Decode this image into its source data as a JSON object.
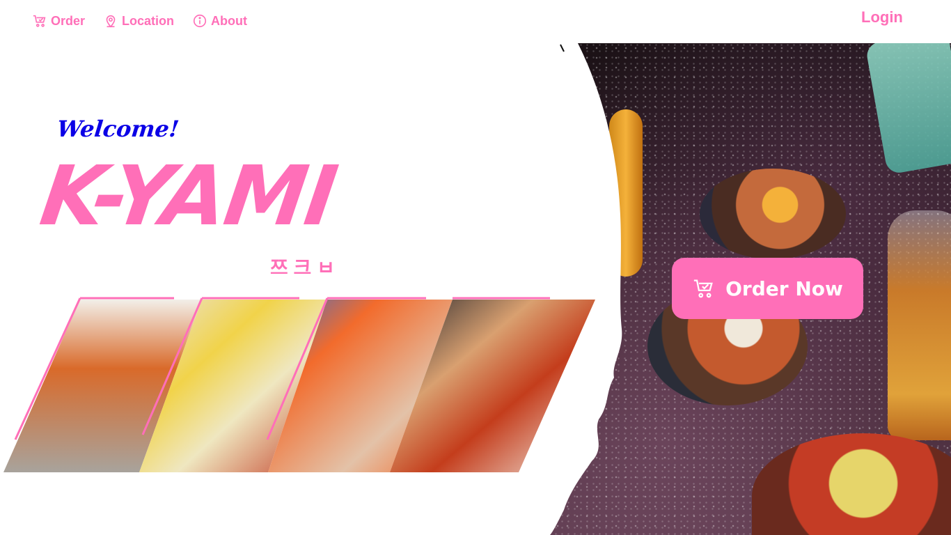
{
  "nav": {
    "items": [
      {
        "label": "Order",
        "icon": "cart-icon"
      },
      {
        "label": "Location",
        "icon": "location-pin-icon"
      },
      {
        "label": "About",
        "icon": "info-icon"
      }
    ],
    "login_label": "Login"
  },
  "hero": {
    "welcome": "Welcome!",
    "brand": "K-YAMI",
    "subtitle_korean": "쯔 크 ㅂ",
    "order_button_label": "Order Now"
  },
  "gallery": {
    "panels": [
      {
        "name": "spicy-fries-skewers"
      },
      {
        "name": "cheese-corn-dogs"
      },
      {
        "name": "loaded-tornado-potatoes"
      },
      {
        "name": "stretchy-cheese-corndog"
      }
    ]
  },
  "colors": {
    "accent": "#ff6fb8",
    "welcome": "#0b00e6",
    "background": "#ffffff"
  }
}
